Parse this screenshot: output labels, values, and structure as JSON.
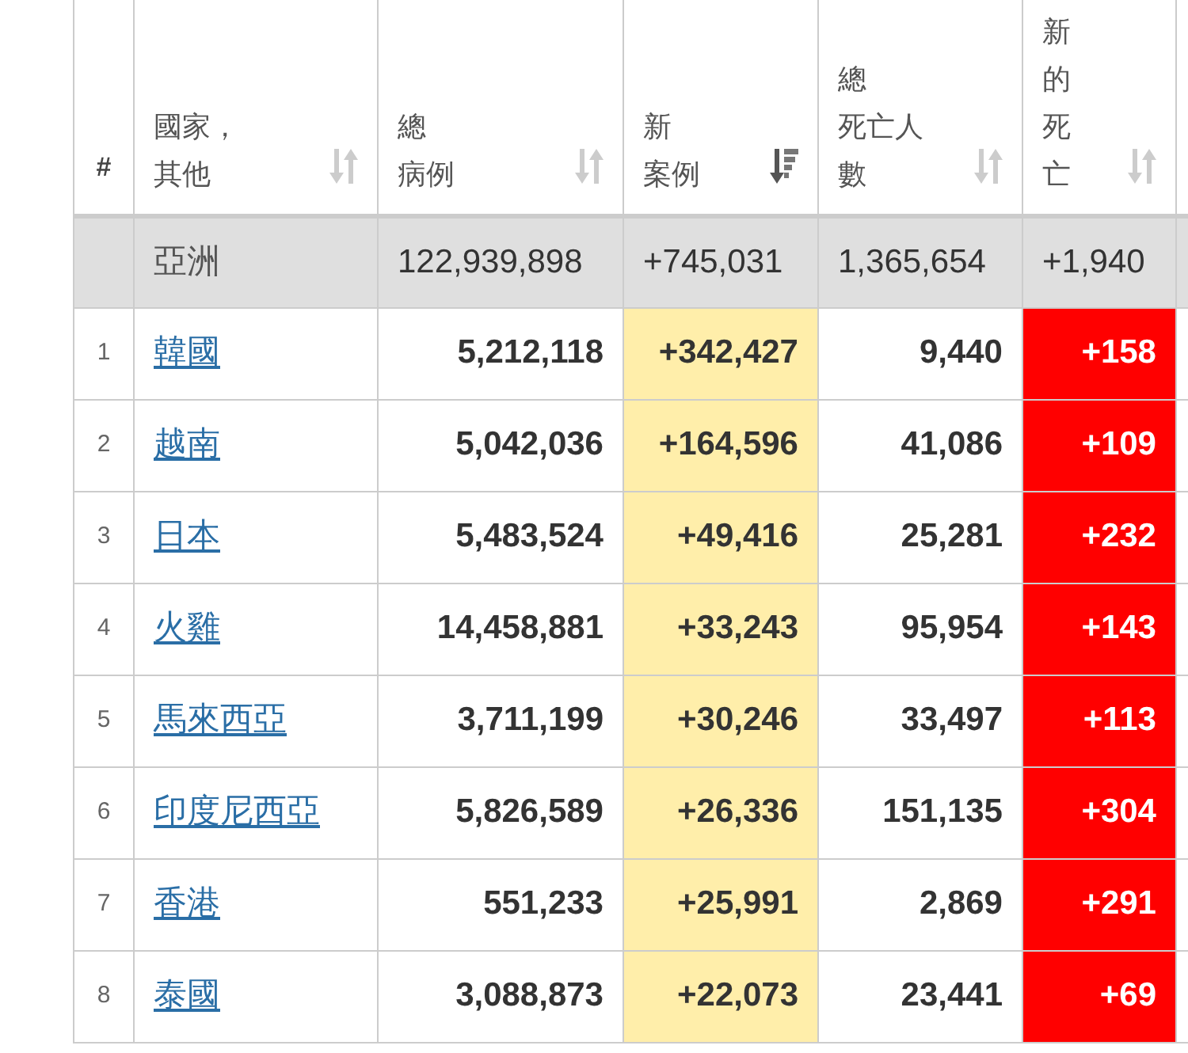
{
  "table": {
    "columns": [
      {
        "label": [
          "#"
        ],
        "kind": "rank"
      },
      {
        "label": [
          "國家，",
          "其他"
        ],
        "sorted": false,
        "kind": "name"
      },
      {
        "label": [
          "總",
          "病例"
        ],
        "sorted": false,
        "kind": "plain"
      },
      {
        "label": [
          "新",
          "案例"
        ],
        "sorted": true,
        "kind": "warning"
      },
      {
        "label": [
          "總",
          "死亡人",
          "數"
        ],
        "sorted": false,
        "kind": "plain"
      },
      {
        "label": [
          "新",
          "的",
          "死",
          "亡"
        ],
        "sorted": false,
        "kind": "danger"
      }
    ],
    "total_row": {
      "cells": [
        "",
        "亞洲",
        "122,939,898",
        "+745,031",
        "1,365,654",
        "+1,940"
      ]
    },
    "rows": [
      {
        "cells": [
          "1",
          "韓國",
          "5,212,118",
          "+342,427",
          "9,440",
          "+158"
        ]
      },
      {
        "cells": [
          "2",
          "越南",
          "5,042,036",
          "+164,596",
          "41,086",
          "+109"
        ]
      },
      {
        "cells": [
          "3",
          "日本",
          "5,483,524",
          "+49,416",
          "25,281",
          "+232"
        ]
      },
      {
        "cells": [
          "4",
          "火雞",
          "14,458,881",
          "+33,243",
          "95,954",
          "+143"
        ]
      },
      {
        "cells": [
          "5",
          "馬來西亞",
          "3,711,199",
          "+30,246",
          "33,497",
          "+113"
        ]
      },
      {
        "cells": [
          "6",
          "印度尼西亞",
          "5,826,589",
          "+26,336",
          "151,135",
          "+304"
        ]
      },
      {
        "cells": [
          "7",
          "香港",
          "551,233",
          "+25,991",
          "2,869",
          "+291"
        ]
      },
      {
        "cells": [
          "8",
          "泰國",
          "3,088,873",
          "+22,073",
          "23,441",
          "+69"
        ]
      }
    ]
  }
}
